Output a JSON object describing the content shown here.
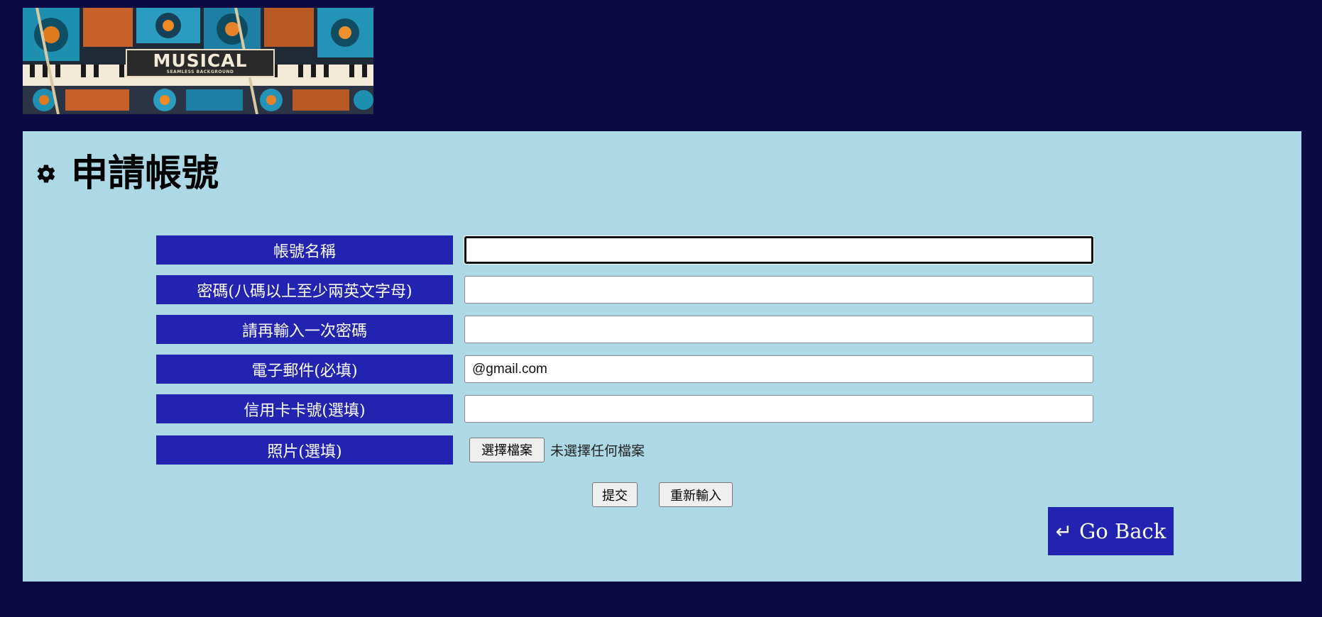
{
  "banner": {
    "title": "MUSICAL",
    "subtitle": "SEAMLESS BACKGROUND"
  },
  "page": {
    "title": "申請帳號",
    "icon": "gear-icon"
  },
  "form": {
    "fields": [
      {
        "label": "帳號名稱",
        "value": "",
        "placeholder": ""
      },
      {
        "label": "密碼(八碼以上至少兩英文字母)",
        "value": "",
        "placeholder": ""
      },
      {
        "label": "請再輸入一次密碼",
        "value": "",
        "placeholder": ""
      },
      {
        "label": "電子郵件(必填)",
        "value": "@gmail.com",
        "placeholder": ""
      },
      {
        "label": "信用卡卡號(選填)",
        "value": "",
        "placeholder": ""
      }
    ],
    "photo": {
      "label": "照片(選填)",
      "button_label": "選擇檔案",
      "status": "未選擇任何檔案"
    },
    "submit_label": "提交",
    "reset_label": "重新輸入"
  },
  "go_back": {
    "arrow": "↵",
    "label": "Go Back"
  },
  "colors": {
    "page_background": "#0b0a45",
    "panel_background": "#add8e6",
    "label_background": "#2323b1"
  }
}
